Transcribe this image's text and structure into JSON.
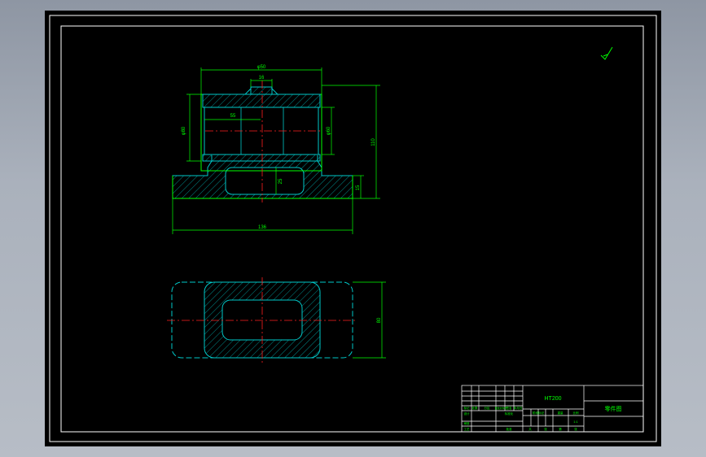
{
  "colors": {
    "background": "#000000",
    "frame": "#ffffff",
    "outline": "#00ff00",
    "hidden_edge": "#00c8c8",
    "hatch": "#00b4b4",
    "center_line": "#ff2020",
    "dimension": "#00ff00",
    "title_text": "#00ff00"
  },
  "front_view": {
    "dims": {
      "top_width": "φ50",
      "key_width": "16",
      "bore_length": "55",
      "left_dia": "φ80",
      "right_dia": "φ60",
      "height": "110",
      "lower_cavity": "25",
      "base_thickness": "15",
      "base_width": "136"
    }
  },
  "plan_view": {
    "dims": {
      "width": "80"
    }
  },
  "roughness_symbol": "roughness-mark",
  "title_block": {
    "material": "HT200",
    "part_name": "零件图",
    "scale": "1:1",
    "row_labels": [
      "标记",
      "处数",
      "分区",
      "更改文件号",
      "签名",
      "年月日"
    ],
    "designer_labels": [
      "设计",
      "标准化"
    ],
    "stage_labels": [
      "阶段标记",
      "重量",
      "比例"
    ],
    "lower_labels": [
      "审核",
      "工艺",
      "批准"
    ],
    "sheet_labels": [
      "共",
      "张",
      "第",
      "张"
    ]
  }
}
